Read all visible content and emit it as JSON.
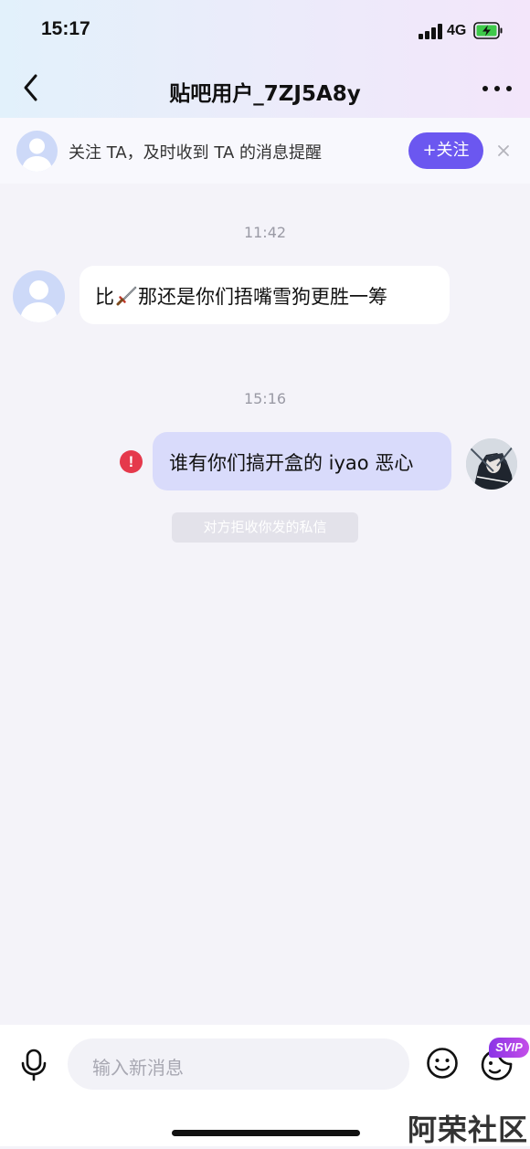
{
  "status_bar": {
    "time": "15:17",
    "network": "4G"
  },
  "header": {
    "title": "贴吧用户_7ZJ5A8y"
  },
  "follow_banner": {
    "text": "关注 TA，及时收到 TA 的消息提醒",
    "button_label": "+关注"
  },
  "messages": [
    {
      "timestamp": "11:42",
      "direction": "incoming",
      "text_before_icon": "比",
      "icon": "sword-emoji-icon",
      "text_after_icon": "那还是你们捂嘴雪狗更胜一筹"
    },
    {
      "timestamp": "15:16",
      "direction": "outgoing",
      "text": "谁有你们搞开盒的 iyao 恶心",
      "status": "failed",
      "status_icon_text": "!",
      "system_notice": "对方拒收你发的私信"
    }
  ],
  "input_bar": {
    "placeholder": "输入新消息",
    "vip_badge": "SVIP"
  },
  "watermark": "阿荣社区",
  "colors": {
    "accent": "#6b57f0",
    "outgoing_bubble": "#d9dbfb",
    "error": "#e5394c",
    "background": "#f4f3f9"
  }
}
